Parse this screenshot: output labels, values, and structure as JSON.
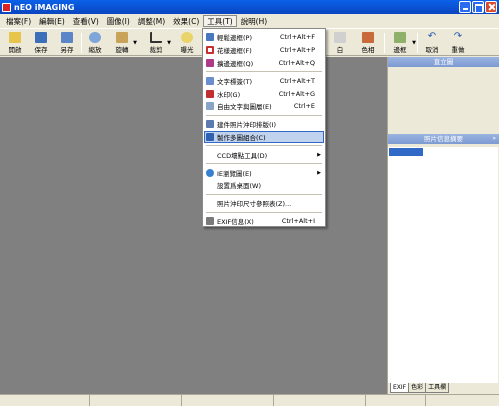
{
  "window": {
    "title": "nEO iMAGING"
  },
  "menubar": [
    {
      "id": "file",
      "label": "檔案(F)"
    },
    {
      "id": "edit",
      "label": "編輯(E)"
    },
    {
      "id": "view",
      "label": "查看(V)"
    },
    {
      "id": "image",
      "label": "圖像(I)"
    },
    {
      "id": "adjust",
      "label": "調整(M)"
    },
    {
      "id": "effect",
      "label": "效果(C)"
    },
    {
      "id": "tools",
      "label": "工具(T)"
    },
    {
      "id": "help",
      "label": "說明(H)"
    }
  ],
  "toolbar": {
    "open": "開啟",
    "save": "保存",
    "saveas": "另存",
    "zoom": "縮放",
    "rotate": "旋轉",
    "crop": "裁剪",
    "exposure": "曝光",
    "white": "白",
    "color": "色相",
    "border": "邊框",
    "undo": "取消",
    "redo": "重做"
  },
  "tools_menu": {
    "items": [
      {
        "id": "border",
        "label": "輕鬆邊框(P)",
        "shortcut": "Ctrl+Alt+F",
        "icon": "border-icon"
      },
      {
        "id": "flower",
        "label": "花樣邊框(F)",
        "shortcut": "Ctrl+Alt+P",
        "icon": "flower-frame-icon"
      },
      {
        "id": "scatter",
        "label": "擴邊邊框(Q)",
        "shortcut": "Ctrl+Alt+Q",
        "icon": "scatter-frame-icon"
      },
      {
        "id": "text",
        "label": "文字標簽(T)",
        "shortcut": "Ctrl+Alt+T",
        "icon": "text-icon"
      },
      {
        "id": "watermark",
        "label": "水印(G)",
        "shortcut": "Ctrl+Alt+G",
        "icon": "watermark-icon"
      },
      {
        "id": "freetext",
        "label": "自由文字與圖層(E)",
        "shortcut": "Ctrl+E",
        "icon": "freetext-icon"
      },
      {
        "id": "batch",
        "label": "建件照片沖印排版(I)",
        "shortcut": "",
        "icon": "batch-print-icon"
      },
      {
        "id": "collage",
        "label": "製作多圖組合(C)",
        "shortcut": "",
        "icon": "collage-icon"
      },
      {
        "id": "ccd",
        "label": "CCD壞點工具(D)",
        "shortcut": "",
        "submenu": true
      },
      {
        "id": "ie",
        "label": "IE瀏覽圖(E)",
        "shortcut": "",
        "icon": "ie-icon",
        "submenu": true
      },
      {
        "id": "wallpaper",
        "label": "設置爲桌面(W)",
        "shortcut": ""
      },
      {
        "id": "printsize",
        "label": "照片沖印尺寸參照表(Z)...",
        "shortcut": ""
      },
      {
        "id": "exif",
        "label": "EXIF信息(X)",
        "shortcut": "Ctrl+Alt+I",
        "icon": "exif-icon"
      }
    ]
  },
  "right_panel": {
    "histogram_title": "直立圖",
    "info_title": "照片信息摘要",
    "tabs": [
      "EXIF",
      "色彩",
      "工具欄"
    ]
  },
  "colors": {
    "titlebar": "#0a4fd0",
    "highlight": "#c1d2ee",
    "canvas": "#808080"
  }
}
